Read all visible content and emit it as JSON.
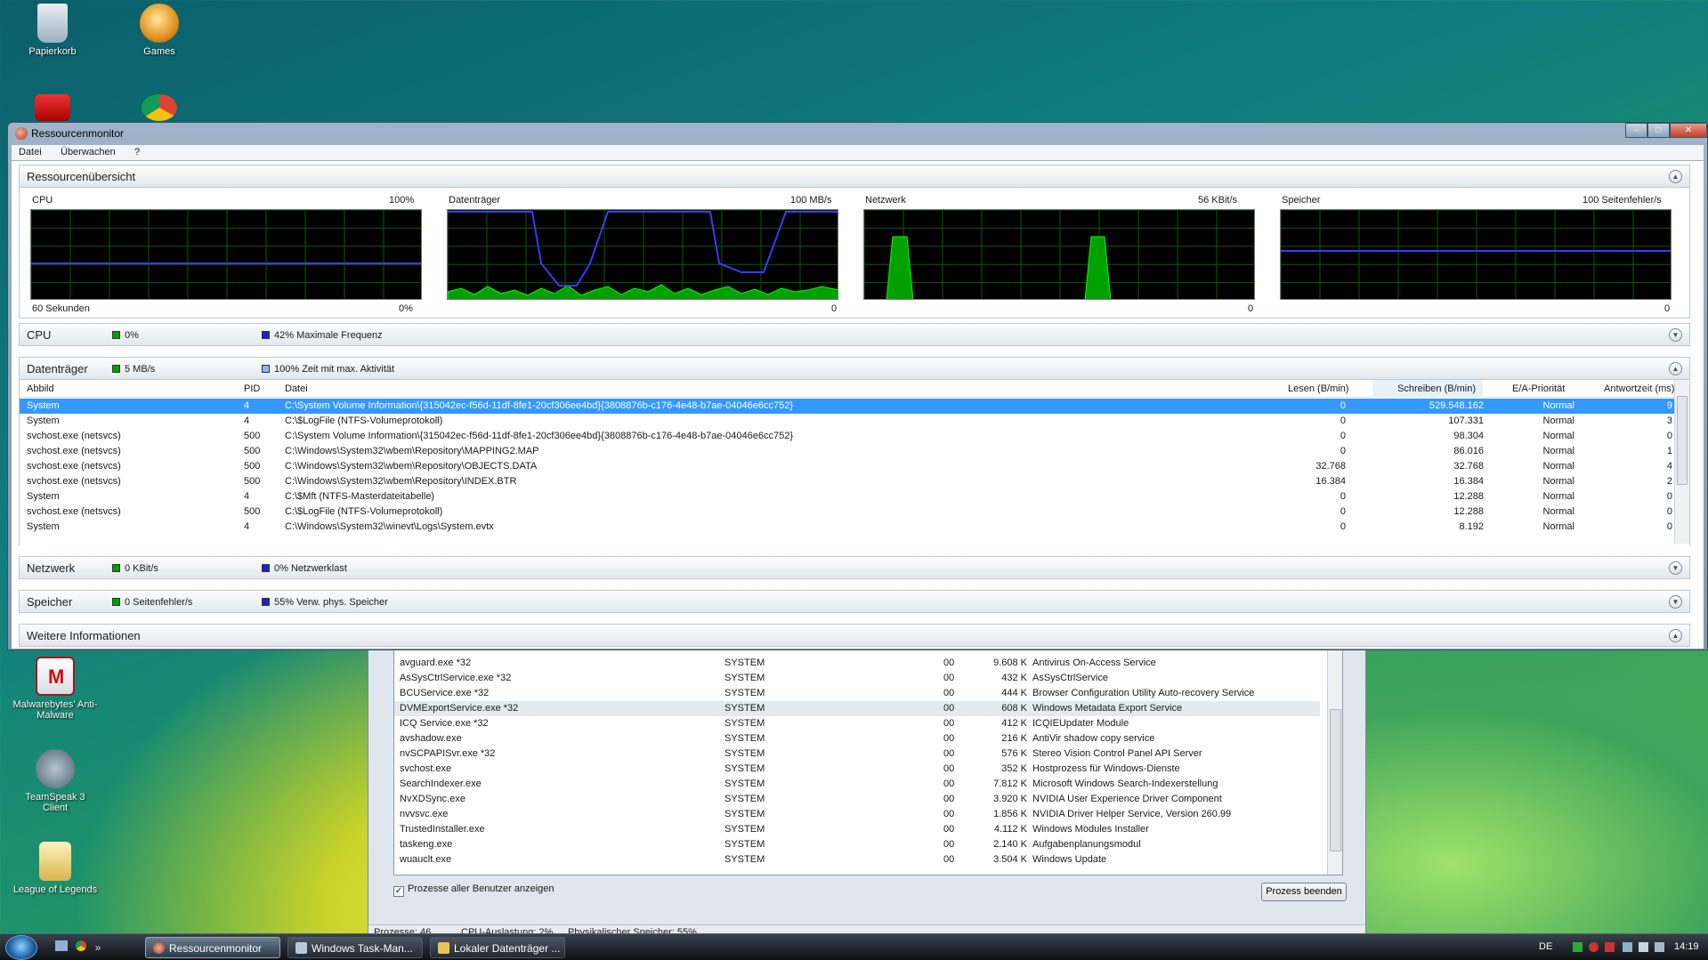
{
  "desktop": {
    "icons": [
      {
        "label": "Papierkorb"
      },
      {
        "label": "Games"
      },
      {
        "label": "Malwarebytes' Anti-Malware"
      },
      {
        "label": "TeamSpeak 3 Client"
      },
      {
        "label": "League of Legends"
      }
    ]
  },
  "resmon": {
    "title": "Ressourcenmonitor",
    "window_buttons": {
      "minimize": "–",
      "maximize": "□",
      "close": "✕"
    },
    "menu": [
      "Datei",
      "Überwachen",
      "?"
    ],
    "overview": {
      "title": "Ressourcenübersicht",
      "toggle": "▲",
      "graphs": [
        {
          "name": "CPU",
          "max": "100%",
          "min": "0%",
          "footer": "60 Sekunden"
        },
        {
          "name": "Datenträger",
          "max": "100 MB/s",
          "min": "0",
          "footer": ""
        },
        {
          "name": "Netzwerk",
          "max": "56 KBit/s",
          "min": "0",
          "footer": ""
        },
        {
          "name": "Speicher",
          "max": "100 Seitenfehler/s",
          "min": "0",
          "footer": ""
        }
      ]
    },
    "sections": {
      "cpu": {
        "title": "CPU",
        "green": "0%",
        "blue": "42% Maximale Frequenz",
        "toggle": "▼"
      },
      "disk": {
        "title": "Datenträger",
        "green": "5 MB/s",
        "blue": "100% Zeit mit max. Aktivität",
        "toggle": "▲"
      },
      "network": {
        "title": "Netzwerk",
        "green": "0 KBit/s",
        "blue": "0% Netzwerklast",
        "toggle": "▼"
      },
      "memory": {
        "title": "Speicher",
        "green": "0 Seitenfehler/s",
        "blue": "55% Verw. phys. Speicher",
        "toggle": "▼"
      },
      "more": {
        "title": "Weitere Informationen",
        "toggle": "▲"
      }
    },
    "disk_table": {
      "columns": [
        "Abbild",
        "PID",
        "Datei",
        "Lesen (B/min)",
        "Schreiben (B/min)",
        "E/A-Priorität",
        "Antwortzeit (ms)"
      ],
      "rows": [
        {
          "abbild": "System",
          "pid": "4",
          "datei": "C:\\System Volume Information\\{315042ec-f56d-11df-8fe1-20cf306ee4bd}{3808876b-c176-4e48-b7ae-04046e6cc752}",
          "lesen": "0",
          "schreiben": "529.548.162",
          "prio": "Normal",
          "antwort": "9"
        },
        {
          "abbild": "System",
          "pid": "4",
          "datei": "C:\\$LogFile (NTFS-Volumeprotokoll)",
          "lesen": "0",
          "schreiben": "107.331",
          "prio": "Normal",
          "antwort": "3"
        },
        {
          "abbild": "svchost.exe (netsvcs)",
          "pid": "500",
          "datei": "C:\\System Volume Information\\{315042ec-f56d-11df-8fe1-20cf306ee4bd}{3808876b-c176-4e48-b7ae-04046e6cc752}",
          "lesen": "0",
          "schreiben": "98.304",
          "prio": "Normal",
          "antwort": "0"
        },
        {
          "abbild": "svchost.exe (netsvcs)",
          "pid": "500",
          "datei": "C:\\Windows\\System32\\wbem\\Repository\\MAPPING2.MAP",
          "lesen": "0",
          "schreiben": "86.016",
          "prio": "Normal",
          "antwort": "1"
        },
        {
          "abbild": "svchost.exe (netsvcs)",
          "pid": "500",
          "datei": "C:\\Windows\\System32\\wbem\\Repository\\OBJECTS.DATA",
          "lesen": "32.768",
          "schreiben": "32.768",
          "prio": "Normal",
          "antwort": "4"
        },
        {
          "abbild": "svchost.exe (netsvcs)",
          "pid": "500",
          "datei": "C:\\Windows\\System32\\wbem\\Repository\\INDEX.BTR",
          "lesen": "16.384",
          "schreiben": "16.384",
          "prio": "Normal",
          "antwort": "2"
        },
        {
          "abbild": "System",
          "pid": "4",
          "datei": "C:\\$Mft (NTFS-Masterdateitabelle)",
          "lesen": "0",
          "schreiben": "12.288",
          "prio": "Normal",
          "antwort": "0"
        },
        {
          "abbild": "svchost.exe (netsvcs)",
          "pid": "500",
          "datei": "C:\\$LogFile (NTFS-Volumeprotokoll)",
          "lesen": "0",
          "schreiben": "12.288",
          "prio": "Normal",
          "antwort": "0"
        },
        {
          "abbild": "System",
          "pid": "4",
          "datei": "C:\\Windows\\System32\\winevt\\Logs\\System.evtx",
          "lesen": "0",
          "schreiben": "8.192",
          "prio": "Normal",
          "antwort": "0"
        }
      ]
    }
  },
  "taskmgr": {
    "rows": [
      {
        "name": "avguard.exe *32",
        "user": "SYSTEM",
        "cpu": "00",
        "mem": "9.608 K",
        "desc": "Antivirus On-Access Service"
      },
      {
        "name": "AsSysCtrlService.exe *32",
        "user": "SYSTEM",
        "cpu": "00",
        "mem": "432 K",
        "desc": "AsSysCtrlService"
      },
      {
        "name": "BCUService.exe *32",
        "user": "SYSTEM",
        "cpu": "00",
        "mem": "444 K",
        "desc": "Browser Configuration Utility Auto-recovery Service"
      },
      {
        "name": "DVMExportService.exe *32",
        "user": "SYSTEM",
        "cpu": "00",
        "mem": "608 K",
        "desc": "Windows Metadata Export Service"
      },
      {
        "name": "ICQ Service.exe *32",
        "user": "SYSTEM",
        "cpu": "00",
        "mem": "412 K",
        "desc": "ICQIEUpdater Module"
      },
      {
        "name": "avshadow.exe",
        "user": "SYSTEM",
        "cpu": "00",
        "mem": "216 K",
        "desc": "AntiVir shadow copy service"
      },
      {
        "name": "nvSCPAPISvr.exe *32",
        "user": "SYSTEM",
        "cpu": "00",
        "mem": "576 K",
        "desc": "Stereo Vision Control Panel API Server"
      },
      {
        "name": "svchost.exe",
        "user": "SYSTEM",
        "cpu": "00",
        "mem": "352 K",
        "desc": "Hostprozess für Windows-Dienste"
      },
      {
        "name": "SearchIndexer.exe",
        "user": "SYSTEM",
        "cpu": "00",
        "mem": "7.812 K",
        "desc": "Microsoft Windows Search-Indexerstellung"
      },
      {
        "name": "NvXDSync.exe",
        "user": "SYSTEM",
        "cpu": "00",
        "mem": "3.920 K",
        "desc": "NVIDIA User Experience Driver Component"
      },
      {
        "name": "nvvsvc.exe",
        "user": "SYSTEM",
        "cpu": "00",
        "mem": "1.856 K",
        "desc": "NVIDIA Driver Helper Service, Version 260.99"
      },
      {
        "name": "TrustedInstaller.exe",
        "user": "SYSTEM",
        "cpu": "00",
        "mem": "4.112 K",
        "desc": "Windows Modules Installer"
      },
      {
        "name": "taskeng.exe",
        "user": "SYSTEM",
        "cpu": "00",
        "mem": "2.140 K",
        "desc": "Aufgabenplanungsmodul"
      },
      {
        "name": "wuauclt.exe",
        "user": "SYSTEM",
        "cpu": "00",
        "mem": "3.504 K",
        "desc": "Windows Update"
      }
    ],
    "show_all_label": "Prozesse aller Benutzer anzeigen",
    "end_process_label": "Prozess beenden",
    "status": {
      "processes": "Prozesse: 46",
      "cpu": "CPU-Auslastung: 2%",
      "memory": "Physikalischer Speicher: 55%"
    }
  },
  "taskbar": {
    "buttons": [
      "Ressourcenmonitor",
      "Windows Task-Man...",
      "Lokaler Datenträger ..."
    ],
    "quick_more": "»",
    "lang": "DE",
    "clock": "14:19"
  },
  "colors": {
    "green": "#00c000",
    "blue": "#3a3aff",
    "selection": "#3399ff"
  }
}
